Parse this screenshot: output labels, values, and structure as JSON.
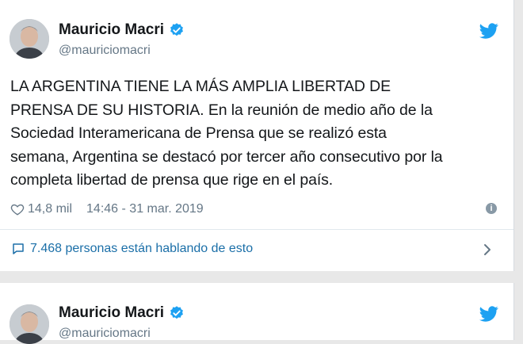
{
  "tweets": [
    {
      "author": {
        "name": "Mauricio Macri",
        "handle": "@mauriciomacri"
      },
      "text_lines": [
        "LA ARGENTINA TIENE LA MÁS AMPLIA LIBERTAD DE",
        "PRENSA DE SU HISTORIA. En la reunión de medio año de la",
        "Sociedad Interamericana de Prensa que se realizó esta",
        "semana, Argentina se destacó por tercer año consecutivo por la",
        "completa libertad de prensa que rige en el país."
      ],
      "likes": "14,8 mil",
      "timestamp": "14:46 - 31 mar. 2019",
      "conversation_label": "7.468 personas están hablando de esto"
    },
    {
      "author": {
        "name": "Mauricio Macri",
        "handle": "@mauriciomacri"
      }
    }
  ],
  "colors": {
    "twitter_blue": "#1da1f2",
    "link_blue": "#1b6fa8",
    "muted_text": "#657786",
    "page_bg": "#e8e8e8"
  },
  "icons": [
    "twitter-bird-icon",
    "verified-badge-icon",
    "heart-icon",
    "info-icon",
    "reply-bubble-icon",
    "chevron-right-icon"
  ]
}
